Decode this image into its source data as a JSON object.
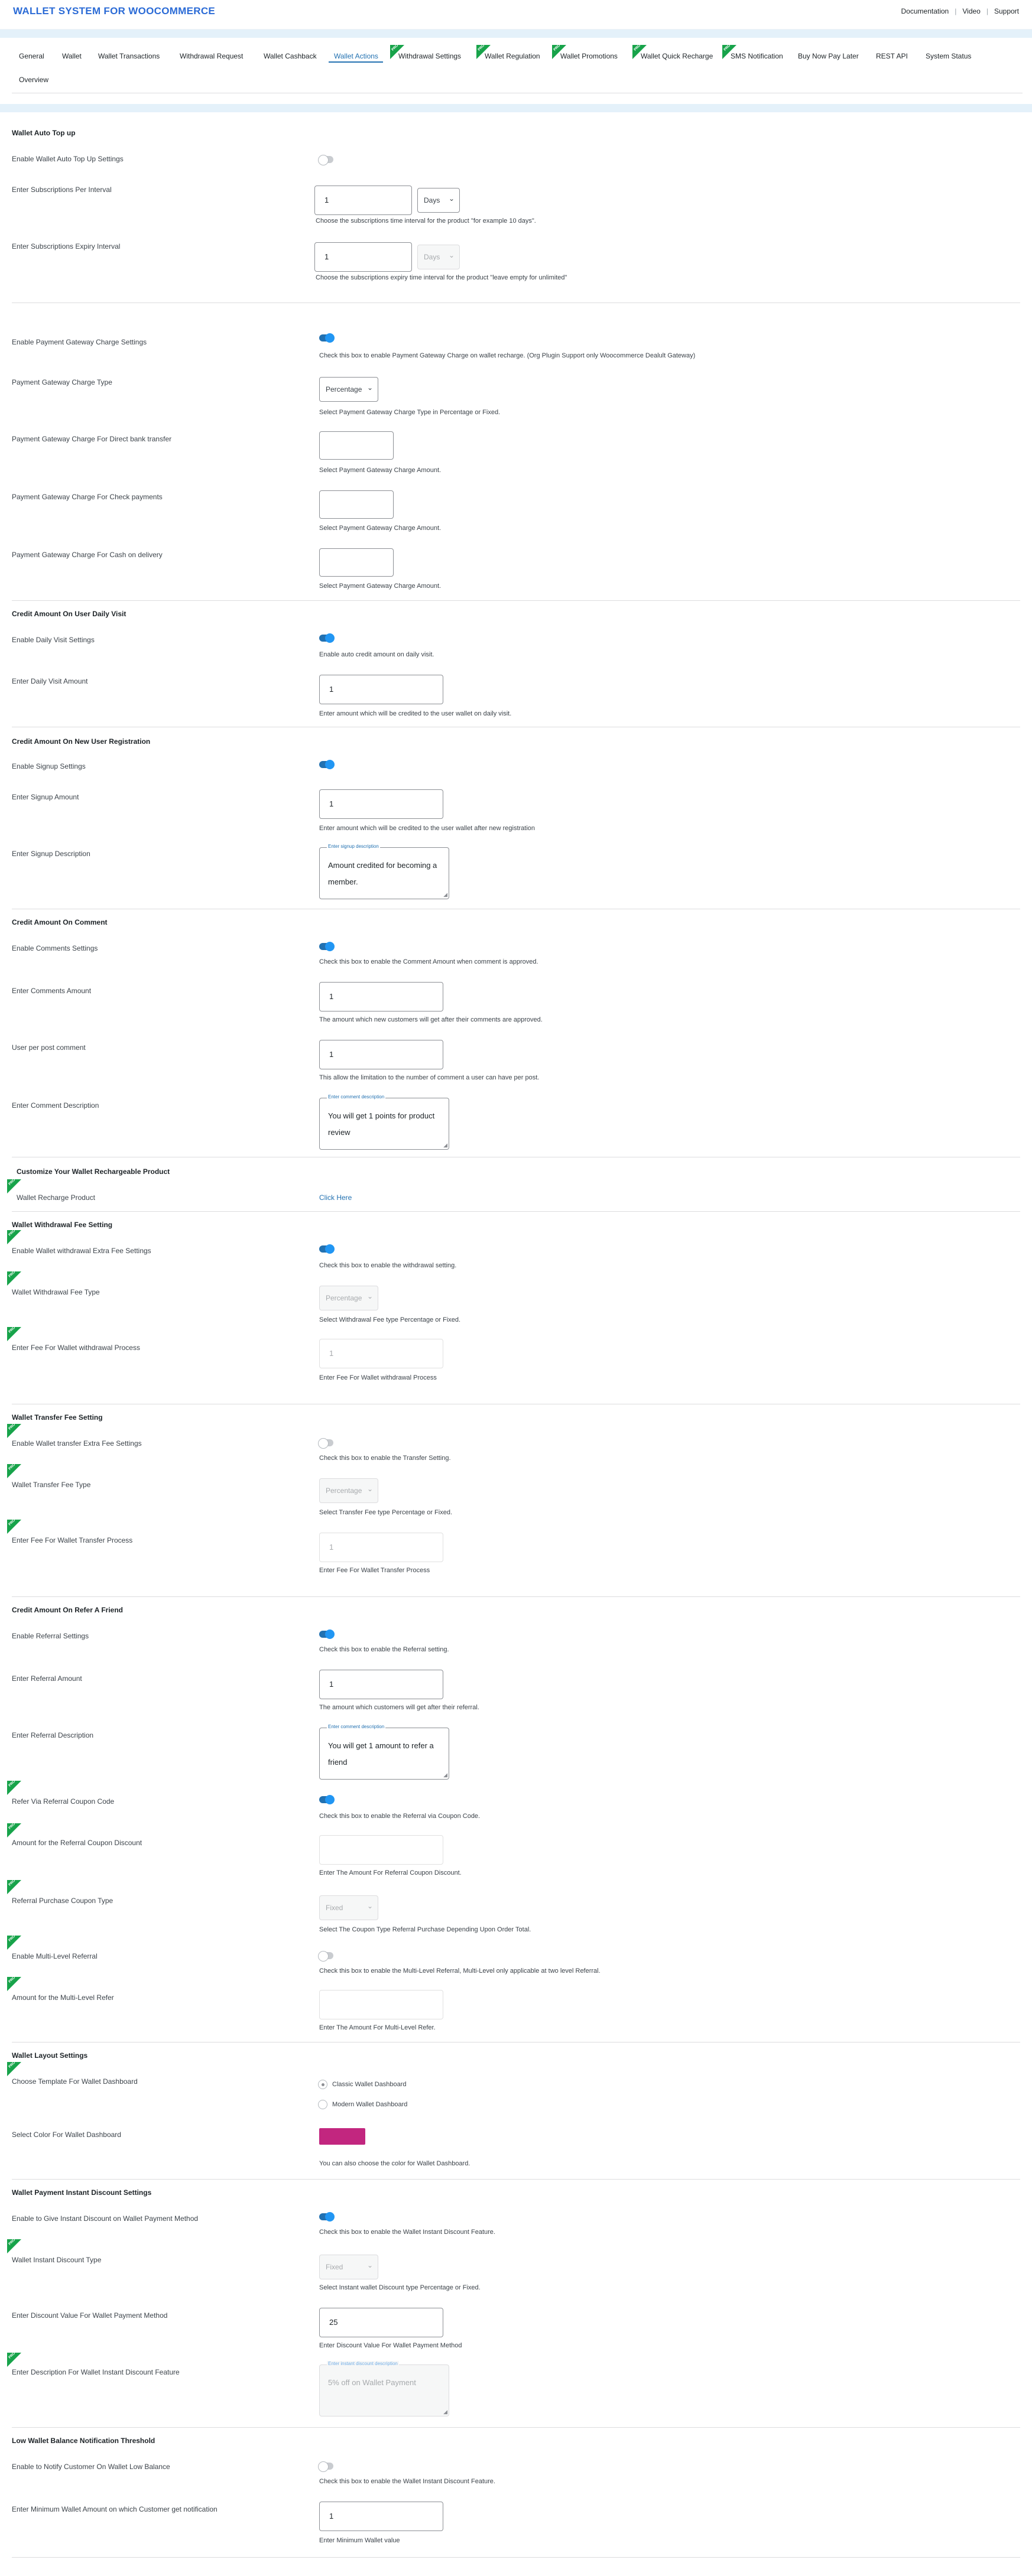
{
  "header": {
    "brand": "WALLET SYSTEM FOR WOOCOMMERCE",
    "links": [
      "Documentation",
      "Video",
      "Support"
    ],
    "separator": "|"
  },
  "tabs": [
    "General",
    "Wallet",
    "Wallet Transactions",
    "Withdrawal Request",
    "Wallet Cashback",
    "Wallet Actions",
    "Withdrawal Settings",
    "Wallet Regulation",
    "Wallet Promotions",
    "Wallet Quick Recharge",
    "SMS Notification",
    "Buy Now Pay Later",
    "REST API",
    "System Status",
    "Overview"
  ],
  "pro_badge": "PRO",
  "colors": {
    "accent": "#2271b1",
    "toggle_on": "#2196f3",
    "pro_badge": "#17a34a",
    "wallet_color": "#c2267f"
  },
  "autotopup": {
    "title": "Wallet Auto Top up",
    "enable_label": "Enable Wallet Auto Top Up Settings",
    "sub_label": "Enter Subscriptions Per Interval",
    "sub_value": "1",
    "sub_unit": "Days",
    "sub_desc": "Choose the subscriptions time interval for the product \"for example 10 days\".",
    "expiry_label": "Enter Subscriptions Expiry Interval",
    "expiry_value": "1",
    "expiry_unit": "Days",
    "expiry_desc": "Choose the subscriptions expiry time interval for the product \"leave empty for unlimited\""
  },
  "gateway": {
    "enable_label": "Enable Payment Gateway Charge Settings",
    "enable_desc": "Check this box to enable Payment Gateway Charge on wallet recharge. (Org Plugin Support only Woocommerce Dealult Gateway)",
    "type_label": "Payment Gateway Charge Type",
    "type_value": "Percentage",
    "type_desc": "Select Payment Gateway Charge Type in Percentage or Fixed.",
    "bank_label": "Payment Gateway Charge For Direct bank transfer",
    "bank_desc": "Select Payment Gateway Charge Amount.",
    "check_label": "Payment Gateway Charge For Check payments",
    "check_desc": "Select Payment Gateway Charge Amount.",
    "cod_label": "Payment Gateway Charge For Cash on delivery",
    "cod_desc": "Select Payment Gateway Charge Amount."
  },
  "daily": {
    "title": "Credit Amount On User Daily Visit",
    "enable_label": "Enable Daily Visit Settings",
    "enable_desc": "Enable auto credit amount on daily visit.",
    "amount_label": "Enter Daily Visit Amount",
    "amount_value": "1",
    "amount_desc": "Enter amount which will be credited to the user wallet on daily visit."
  },
  "signup": {
    "title": "Credit Amount On New User Registration",
    "enable_label": "Enable Signup Settings",
    "amount_label": "Enter Signup Amount",
    "amount_value": "1",
    "amount_desc": "Enter amount which will be credited to the user wallet after new registration",
    "desc_label": "Enter Signup Description",
    "desc_legend": "Enter signup description",
    "desc_value": "Amount credited for becoming a member."
  },
  "comment": {
    "title": "Credit Amount On Comment",
    "enable_label": "Enable Comments Settings",
    "enable_desc": "Check this box to enable the Comment Amount when comment is approved.",
    "amount_label": "Enter Comments Amount",
    "amount_value": "1",
    "amount_desc": "The amount which new customers will get after their comments are approved.",
    "per_label": "User per post comment",
    "per_value": "1",
    "per_desc": "This allow the limitation to the number of comment a user can have per post.",
    "desc_label": "Enter Comment Description",
    "desc_legend": "Enter comment description",
    "desc_value": "You will get 1 points for product review"
  },
  "recharge": {
    "title": "Customize Your Wallet Rechargeable Product",
    "label": "Wallet Recharge Product",
    "link": "Click Here"
  },
  "withdrawal_fee": {
    "title": "Wallet Withdrawal Fee Setting",
    "enable_label": "Enable Wallet withdrawal Extra Fee Settings",
    "enable_desc": "Check this box to enable the withdrawal setting.",
    "type_label": "Wallet Withdrawal Fee Type",
    "type_value": "Percentage",
    "type_desc": "Select Withdrawal Fee type Percentage or Fixed.",
    "fee_label": "Enter Fee For Wallet withdrawal Process",
    "fee_value": "1",
    "fee_desc": "Enter Fee For Wallet withdrawal Process"
  },
  "transfer_fee": {
    "title": "Wallet Transfer Fee Setting",
    "enable_label": "Enable Wallet transfer Extra Fee Settings",
    "enable_desc": "Check this box to enable the Transfer Setting.",
    "type_label": "Wallet Transfer Fee Type",
    "type_value": "Percentage",
    "type_desc": "Select Transfer Fee type Percentage or Fixed.",
    "fee_label": "Enter Fee For Wallet Transfer Process",
    "fee_value": "1",
    "fee_desc": "Enter Fee For Wallet Transfer Process"
  },
  "referral": {
    "title": "Credit Amount On Refer A Friend",
    "enable_label": "Enable Referral Settings",
    "enable_desc": "Check this box to enable the Referral setting.",
    "amount_label": "Enter Referral Amount",
    "amount_value": "1",
    "amount_desc": "The amount which customers will get after their referral.",
    "desc_label": "Enter Referral Description",
    "desc_legend": "Enter comment description",
    "desc_value": "You will get 1 amount to refer a friend",
    "coupon_label": "Refer Via Referral Coupon Code",
    "coupon_desc": "Check this box to enable the Referral via Coupon Code.",
    "coupon_amount_label": "Amount for the Referral Coupon Discount",
    "coupon_amount_desc": "Enter The Amount For Referral Coupon Discount.",
    "purchase_label": "Referral Purchase Coupon Type",
    "purchase_value": "Fixed",
    "purchase_desc": "Select The Coupon Type Referral Purchase Depending Upon Order Total.",
    "multi_label": "Enable Multi-Level Referral",
    "multi_desc": "Check this box to enable the Multi-Level Referral, Multi-Level only applicable at two level Referral.",
    "multi_amount_label": "Amount for the Multi-Level Refer",
    "multi_amount_desc": "Enter The Amount For Multi-Level Refer."
  },
  "layout": {
    "title": "Wallet Layout Settings",
    "template_label": "Choose Template For Wallet Dashboard",
    "option_classic": "Classic Wallet Dashboard",
    "option_modern": "Modern Wallet Dashboard",
    "color_label": "Select Color For Wallet Dashboard",
    "color_desc": "You can also choose the color for Wallet Dashboard."
  },
  "instant": {
    "title": "Wallet Payment Instant Discount Settings",
    "enable_label": "Enable to Give Instant Discount on Wallet Payment Method",
    "enable_desc": "Check this box to enable the Wallet Instant Discount Feature.",
    "type_label": "Wallet Instant Discount Type",
    "type_value": "Fixed",
    "type_desc": "Select Instant wallet Discount type Percentage or Fixed.",
    "value_label": "Enter Discount Value For Wallet Payment Method",
    "value_value": "25",
    "value_desc": "Enter Discount Value For Wallet Payment Method",
    "desc_label": "Enter Description For Wallet Instant Discount Feature",
    "desc_legend": "Enter instant discount description",
    "desc_value": "5% off on Wallet Payment"
  },
  "lowbal": {
    "title": "Low Wallet Balance Notification Threshold",
    "enable_label": "Enable to Notify Customer On Wallet Low Balance",
    "enable_desc": "Check this box to enable the Wallet Instant Discount Feature.",
    "min_label": "Enter Minimum Wallet Amount on which Customer get notification",
    "min_value": "1",
    "min_desc": "Enter Minimum Wallet value"
  }
}
